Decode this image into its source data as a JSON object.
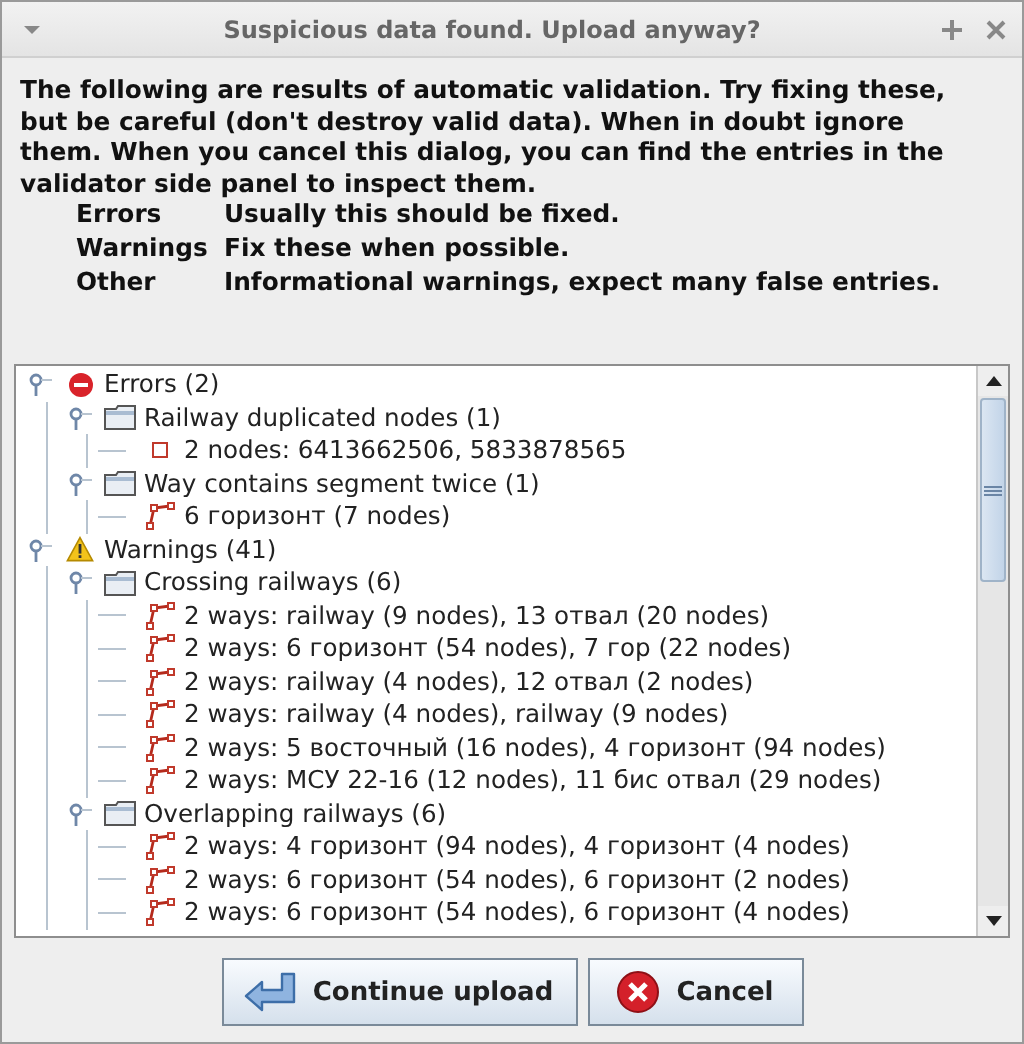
{
  "window": {
    "title": "Suspicious data found. Upload anyway?"
  },
  "message": "The following are results of automatic validation. Try fixing these, but be careful (don't destroy valid data). When in doubt ignore them. When you cancel this dialog, you can find the entries in the validator side panel to inspect them.",
  "legend": [
    {
      "term": "Errors",
      "description": "Usually this should be fixed."
    },
    {
      "term": "Warnings",
      "description": "Fix these when possible."
    },
    {
      "term": "Other",
      "description": "Informational warnings, expect many false entries."
    }
  ],
  "tree": [
    {
      "kind": "error",
      "label": "Errors (2)",
      "expanded": true,
      "children": [
        {
          "kind": "group",
          "label": "Railway duplicated nodes (1)",
          "expanded": true,
          "children": [
            {
              "kind": "node",
              "label": "2 nodes: 6413662506, 5833878565"
            }
          ]
        },
        {
          "kind": "group",
          "label": "Way contains segment twice (1)",
          "expanded": true,
          "children": [
            {
              "kind": "way",
              "label": "6 горизонт (7 nodes)"
            }
          ]
        }
      ]
    },
    {
      "kind": "warning",
      "label": "Warnings (41)",
      "expanded": true,
      "children": [
        {
          "kind": "group",
          "label": "Crossing railways (6)",
          "expanded": true,
          "children": [
            {
              "kind": "way",
              "label": "2 ways: railway (9 nodes), 13 отвал (20 nodes)"
            },
            {
              "kind": "way",
              "label": "2 ways: 6 горизонт (54 nodes), 7 гор (22 nodes)"
            },
            {
              "kind": "way",
              "label": "2 ways: railway (4 nodes), 12 отвал (2 nodes)"
            },
            {
              "kind": "way",
              "label": "2 ways: railway (4 nodes), railway (9 nodes)"
            },
            {
              "kind": "way",
              "label": "2 ways: 5 восточный (16 nodes), 4 горизонт (94 nodes)"
            },
            {
              "kind": "way",
              "label": "2 ways: МСУ 22-16 (12 nodes), 11 бис отвал (29 nodes)"
            }
          ]
        },
        {
          "kind": "group",
          "label": "Overlapping railways (6)",
          "expanded": true,
          "children": [
            {
              "kind": "way",
              "label": "2 ways: 4 горизонт (94 nodes), 4 горизонт (4 nodes)"
            },
            {
              "kind": "way",
              "label": "2 ways: 6 горизонт (54 nodes), 6 горизонт (2 nodes)"
            },
            {
              "kind": "way",
              "label": "2 ways: 6 горизонт (54 nodes), 6 горизонт (4 nodes)"
            }
          ]
        }
      ]
    }
  ],
  "buttons": [
    {
      "kind": "continue",
      "label": "Continue upload"
    },
    {
      "kind": "cancel",
      "label": "Cancel"
    }
  ]
}
